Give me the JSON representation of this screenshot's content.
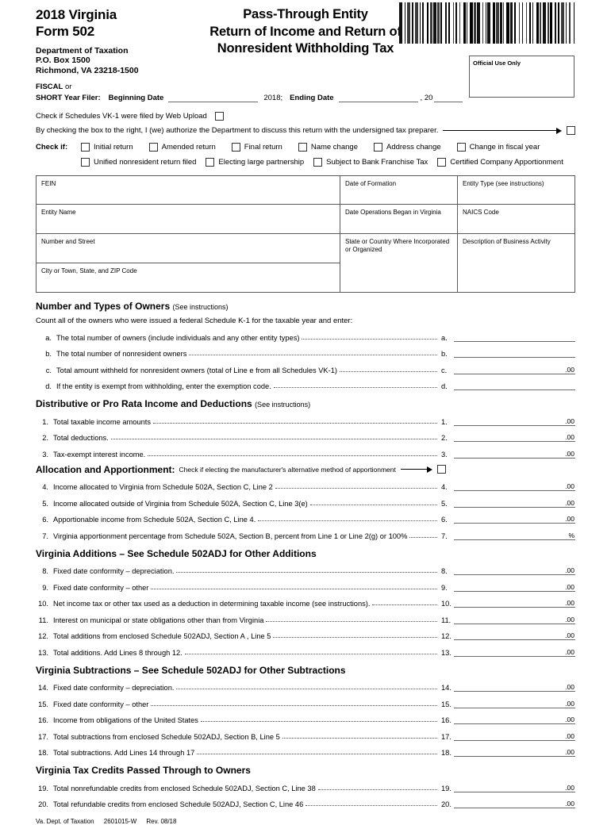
{
  "header": {
    "year_form_line1": "2018 Virginia",
    "year_form_line2": "Form 502",
    "dept_line1": "Department of Taxation",
    "dept_line2": "P.O. Box 1500",
    "dept_line3": "Richmond, VA 23218-1500",
    "title_line1": "Pass-Through Entity",
    "title_line2": "Return of Income and Return of",
    "title_line3": "Nonresident Withholding Tax",
    "official_use": "Official Use Only"
  },
  "fiscal": {
    "label_line1_bold": "FISCAL",
    "label_line1_thin": " or",
    "label_line2": "SHORT Year Filer:",
    "beginning_label": "Beginning Date",
    "year_mid": "2018;",
    "ending_label": "Ending Date",
    "year_end": ", 20"
  },
  "checks": {
    "web_upload": "Check if Schedules VK-1 were filed by Web Upload",
    "authorize": "By checking the box to the right, I (we) authorize the Department to discuss this return with the undersigned tax preparer.",
    "check_if_label": "Check if:",
    "row1": [
      "Initial return",
      "Amended return",
      "Final return",
      "Name change",
      "Address change",
      "Change in fiscal year"
    ],
    "row2": [
      "Unified nonresident return filed",
      "Electing large partnership",
      "Subject to Bank Franchise Tax",
      "Certified Company Apportionment"
    ]
  },
  "entity_table": {
    "fein": "FEIN",
    "date_of_formation": "Date of Formation",
    "entity_type": "Entity Type (see instructions)",
    "entity_name": "Entity Name",
    "date_ops_began": "Date Operations Began in Virginia",
    "naics_code": "NAICS Code",
    "number_street": "Number and Street",
    "state_country": "State or Country Where Incorporated or Organized",
    "business_activity": "Description of Business Activity",
    "city_town": "City or Town, State, and ZIP Code"
  },
  "owners_section": {
    "heading": "Number and Types of Owners",
    "heading_note": "(See instructions)",
    "intro": "Count all of the owners who were issued a federal Schedule K-1 for the taxable year and enter:",
    "lines": [
      {
        "num": "a.",
        "key": "a.",
        "label": "The total number of owners (include individuals and any other entity types)",
        "suffix": ""
      },
      {
        "num": "b.",
        "key": "b.",
        "label": "The total number of nonresident owners",
        "suffix": ""
      },
      {
        "num": "c.",
        "key": "c.",
        "label": "Total amount withheld for nonresident owners (total of Line e from all Schedules VK-1)",
        "suffix": ".00"
      },
      {
        "num": "d.",
        "key": "d.",
        "label": "If the entity is exempt from withholding, enter the exemption code.",
        "suffix": ""
      }
    ]
  },
  "distributive_section": {
    "heading": "Distributive or Pro Rata Income and Deductions",
    "heading_note": "(See instructions)",
    "lines": [
      {
        "num": "1.",
        "key": "1.",
        "label": "Total taxable income amounts",
        "suffix": ".00"
      },
      {
        "num": "2.",
        "key": "2.",
        "label": "Total deductions.",
        "suffix": ".00"
      },
      {
        "num": "3.",
        "key": "3.",
        "label": "Tax-exempt interest income.",
        "suffix": ".00"
      }
    ]
  },
  "allocation_section": {
    "title": "Allocation and Apportionment:",
    "subtitle": "Check if electing the manufacturer's alternative method of apportionment",
    "lines": [
      {
        "num": "4.",
        "key": "4.",
        "label": "Income allocated to Virginia from Schedule 502A, Section C, Line 2",
        "suffix": ".00"
      },
      {
        "num": "5.",
        "key": "5.",
        "label": "Income allocated outside of Virginia from Schedule 502A, Section C, Line 3(e)",
        "suffix": ".00"
      },
      {
        "num": "6.",
        "key": "6.",
        "label": "Apportionable income from Schedule 502A, Section C, Line 4.",
        "suffix": ".00"
      },
      {
        "num": "7.",
        "key": "7.",
        "label": "Virginia apportionment percentage from Schedule 502A, Section B, percent from Line 1 or Line 2(g) or 100%",
        "suffix": "%"
      }
    ]
  },
  "additions_section": {
    "heading": "Virginia Additions – See Schedule 502ADJ for Other Additions",
    "lines": [
      {
        "num": "8.",
        "key": "8.",
        "label": "Fixed date conformity – depreciation.",
        "suffix": ".00"
      },
      {
        "num": "9.",
        "key": "9.",
        "label": "Fixed date conformity – other",
        "suffix": ".00"
      },
      {
        "num": "10.",
        "key": "10.",
        "label": "Net income tax or other tax used as a deduction in determining taxable income (see instructions).",
        "suffix": ".00"
      },
      {
        "num": "11.",
        "key": "11.",
        "label": "Interest on municipal or state obligations other than from Virginia",
        "suffix": ".00"
      },
      {
        "num": "12.",
        "key": "12.",
        "label": "Total additions from enclosed Schedule 502ADJ, Section A , Line 5",
        "suffix": ".00"
      },
      {
        "num": "13.",
        "key": "13.",
        "label": "Total additions. Add Lines 8 through 12.",
        "suffix": ".00"
      }
    ]
  },
  "subtractions_section": {
    "heading": "Virginia Subtractions – See Schedule 502ADJ for Other Subtractions",
    "lines": [
      {
        "num": "14.",
        "key": "14.",
        "label": "Fixed date conformity – depreciation.",
        "suffix": ".00"
      },
      {
        "num": "15.",
        "key": "15.",
        "label": "Fixed date conformity – other",
        "suffix": ".00"
      },
      {
        "num": "16.",
        "key": "16.",
        "label": "Income from obligations of the United States",
        "suffix": ".00"
      },
      {
        "num": "17.",
        "key": "17.",
        "label": "Total subtractions from enclosed Schedule 502ADJ, Section B, Line 5",
        "suffix": ".00"
      },
      {
        "num": "18.",
        "key": "18.",
        "label": "Total subtractions. Add Lines 14 through 17",
        "suffix": ".00"
      }
    ]
  },
  "credits_section": {
    "heading": "Virginia Tax Credits Passed Through to Owners",
    "lines": [
      {
        "num": "19.",
        "key": "19.",
        "label": "Total nonrefundable credits from enclosed Schedule 502ADJ, Section C, Line 38",
        "suffix": ".00"
      },
      {
        "num": "20.",
        "key": "20.",
        "label": "Total refundable credits from enclosed Schedule 502ADJ, Section C, Line 46",
        "suffix": ".00"
      }
    ]
  },
  "footer": {
    "agency": "Va. Dept. of Taxation",
    "form_code": "2601015-W",
    "revision": "Rev. 08/18"
  }
}
